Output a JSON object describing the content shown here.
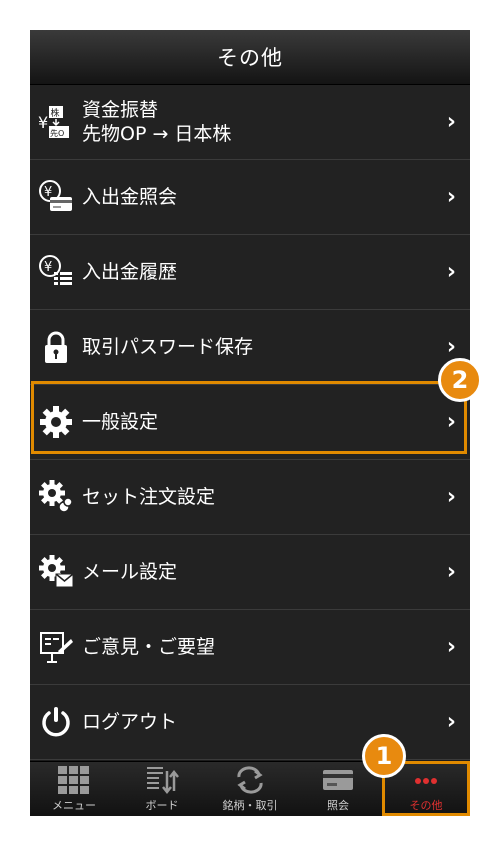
{
  "header": {
    "title": "その他"
  },
  "menu": [
    {
      "icon": "transfer-yen-icon",
      "label_line1": "資金振替",
      "label_line2": "先物OP → 日本株"
    },
    {
      "icon": "yen-card-icon",
      "label": "入出金照会"
    },
    {
      "icon": "yen-list-icon",
      "label": "入出金履歴"
    },
    {
      "icon": "lock-icon",
      "label": "取引パスワード保存"
    },
    {
      "icon": "gear-icon",
      "label": "一般設定"
    },
    {
      "icon": "gear-set-icon",
      "label": "セット注文設定"
    },
    {
      "icon": "gear-mail-icon",
      "label": "メール設定"
    },
    {
      "icon": "feedback-icon",
      "label": "ご意見・ご要望"
    },
    {
      "icon": "power-icon",
      "label": "ログアウト"
    }
  ],
  "tabs": [
    {
      "icon": "grid-icon",
      "label": "メニュー"
    },
    {
      "icon": "board-icon",
      "label": "ボード"
    },
    {
      "icon": "swap-icon",
      "label": "銘柄・取引"
    },
    {
      "icon": "card-icon",
      "label": "照会"
    },
    {
      "icon": "more-dots-icon",
      "label": "その他",
      "active": true
    }
  ],
  "annotations": {
    "badge1": "1",
    "badge2": "2"
  },
  "colors": {
    "highlight": "#e08a00",
    "active_tab": "#e03030"
  },
  "icon_text": {
    "kabu": "株",
    "sakimono": "先O",
    "yen": "¥"
  }
}
